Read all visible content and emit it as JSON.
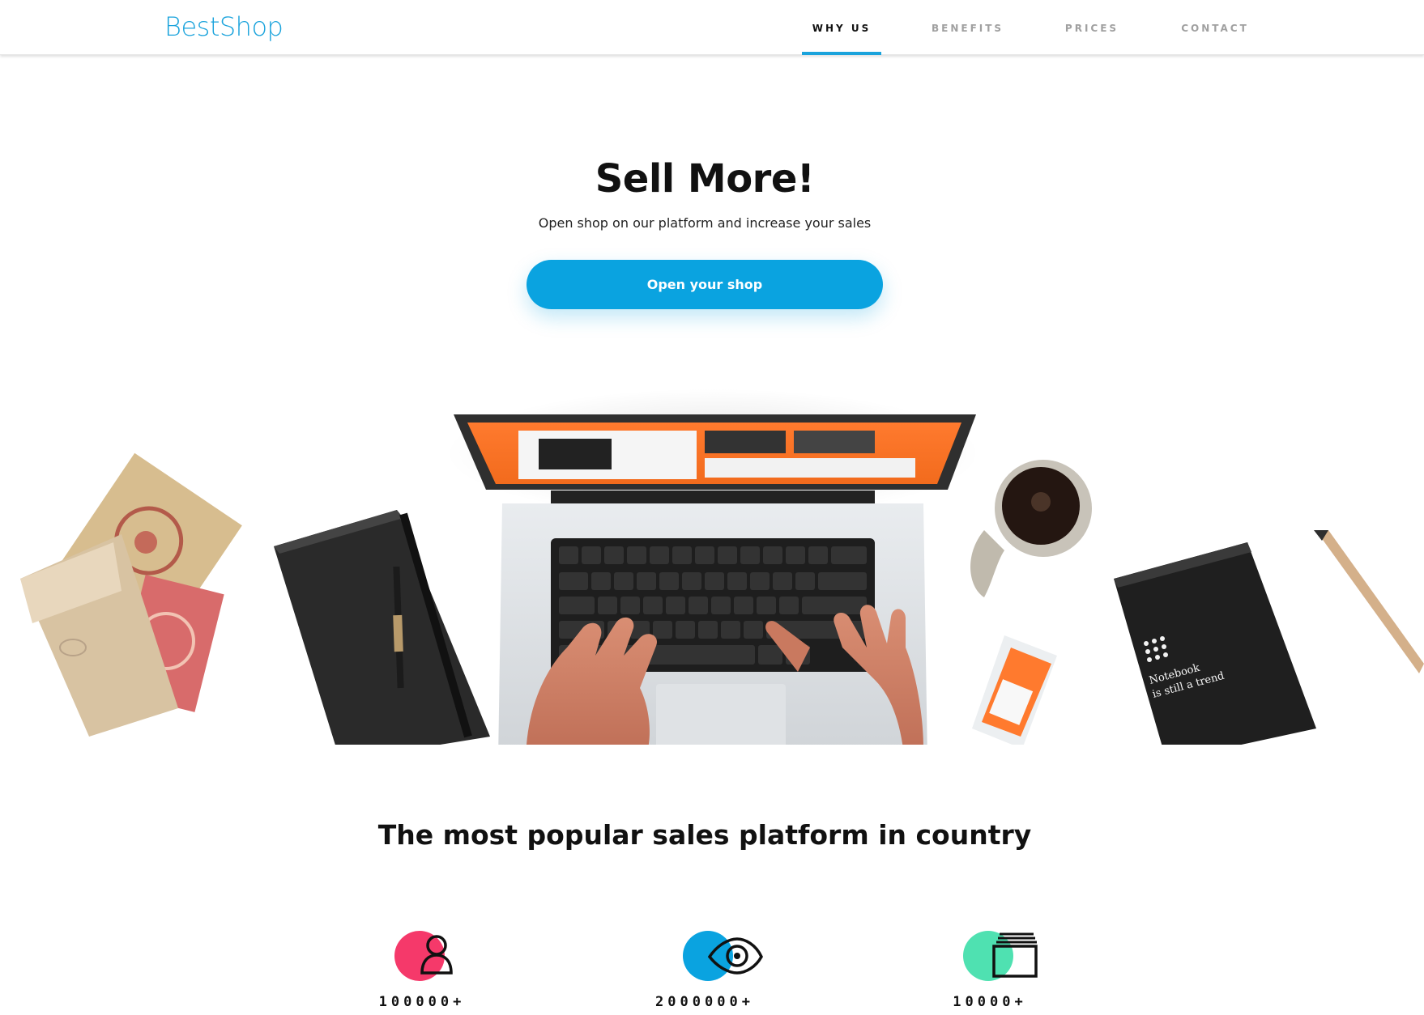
{
  "header": {
    "logo": "BestShop",
    "nav": [
      {
        "label": "WHY US",
        "active": true
      },
      {
        "label": "BENEFITS",
        "active": false
      },
      {
        "label": "PRICES",
        "active": false
      },
      {
        "label": "CONTACT",
        "active": false
      }
    ]
  },
  "hero": {
    "title": "Sell More!",
    "subtitle": "Open shop on our platform and increase your sales",
    "cta_label": "Open your shop",
    "notebook_text_line1": "Notebook",
    "notebook_text_line2": "is still a trend"
  },
  "section": {
    "title": "The most popular sales platform in country",
    "stats": [
      {
        "value": "100000+",
        "icon": "user-icon",
        "color": "#f5396a"
      },
      {
        "value": "2000000+",
        "icon": "eye-icon",
        "color": "#0aa3e0"
      },
      {
        "value": "10000+",
        "icon": "stack-icon",
        "color": "#4fe1b1"
      }
    ]
  },
  "colors": {
    "accent": "#1aa3dc",
    "button": "#0aa3e0"
  }
}
